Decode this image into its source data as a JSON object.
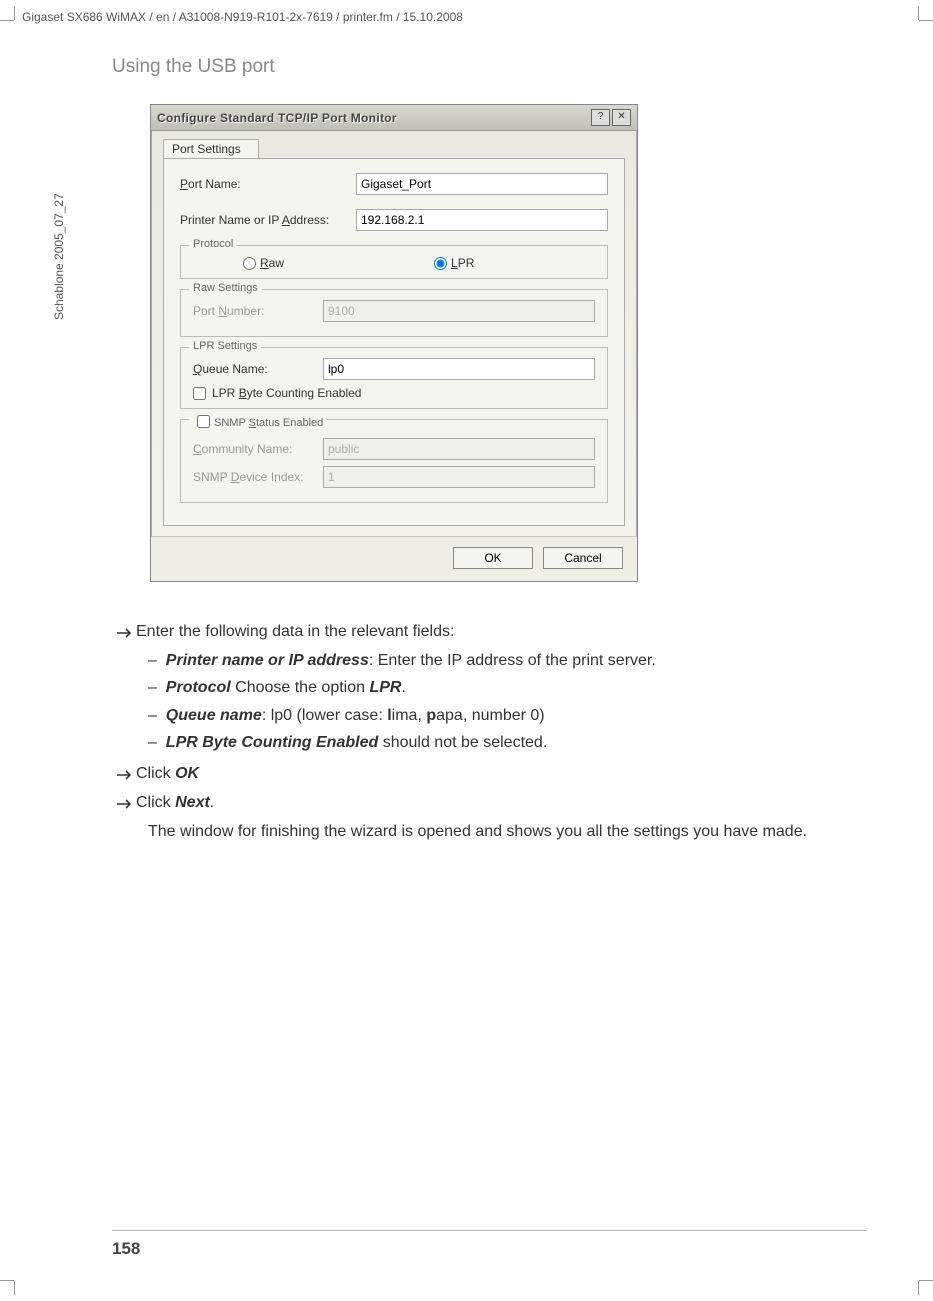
{
  "header": "Gigaset SX686 WiMAX / en / A31008-N919-R101-2x-7619 / printer.fm / 15.10.2008",
  "side": "Schablone 2005_07_27",
  "section": "Using the USB port",
  "pagenum": "158",
  "dlg": {
    "title": "Configure Standard TCP/IP Port Monitor",
    "help": "?",
    "close": "✕",
    "tab": "Port Settings",
    "portname_l": "Port Name:",
    "portname_v": "Gigaset_Port",
    "addr_l": "Printer Name or IP Address:",
    "addr_v": "192.168.2.1",
    "proto_l": "Protocol",
    "raw": "Raw",
    "lpr": "LPR",
    "rawset": "Raw Settings",
    "portnum_l": "Port Number:",
    "portnum_v": "9100",
    "lprset": "LPR Settings",
    "queue_l": "Queue Name:",
    "queue_v": "lp0",
    "lprbyte": "LPR Byte Counting Enabled",
    "snmp": "SNMP Status Enabled",
    "comm_l": "Community Name:",
    "comm_v": "public",
    "idx_l": "SNMP Device Index:",
    "idx_v": "1",
    "ok": "OK",
    "cancel": "Cancel"
  },
  "t": {
    "l1": "Enter the following data in the relevant fields:",
    "s1a": "Printer name or IP address",
    "s1b": ": Enter the IP address of the print server.",
    "s2a": "Protocol",
    "s2b": " Choose the option ",
    "s2c": "LPR",
    "s2d": ".",
    "s3a": "Queue name",
    "s3b": ": lp0 (lower case: ",
    "s3c": "l",
    "s3d": "ima, ",
    "s3e": "p",
    "s3f": "apa, number 0)",
    "s4a": "LPR Byte Counting Enabled",
    "s4b": " should not be selected.",
    "l2a": "Click ",
    "l2b": "OK",
    "l3a": "Click ",
    "l3b": "Next",
    "l3c": ".",
    "p": "The window for finishing the wizard is opened and shows you all the settings you have made."
  }
}
